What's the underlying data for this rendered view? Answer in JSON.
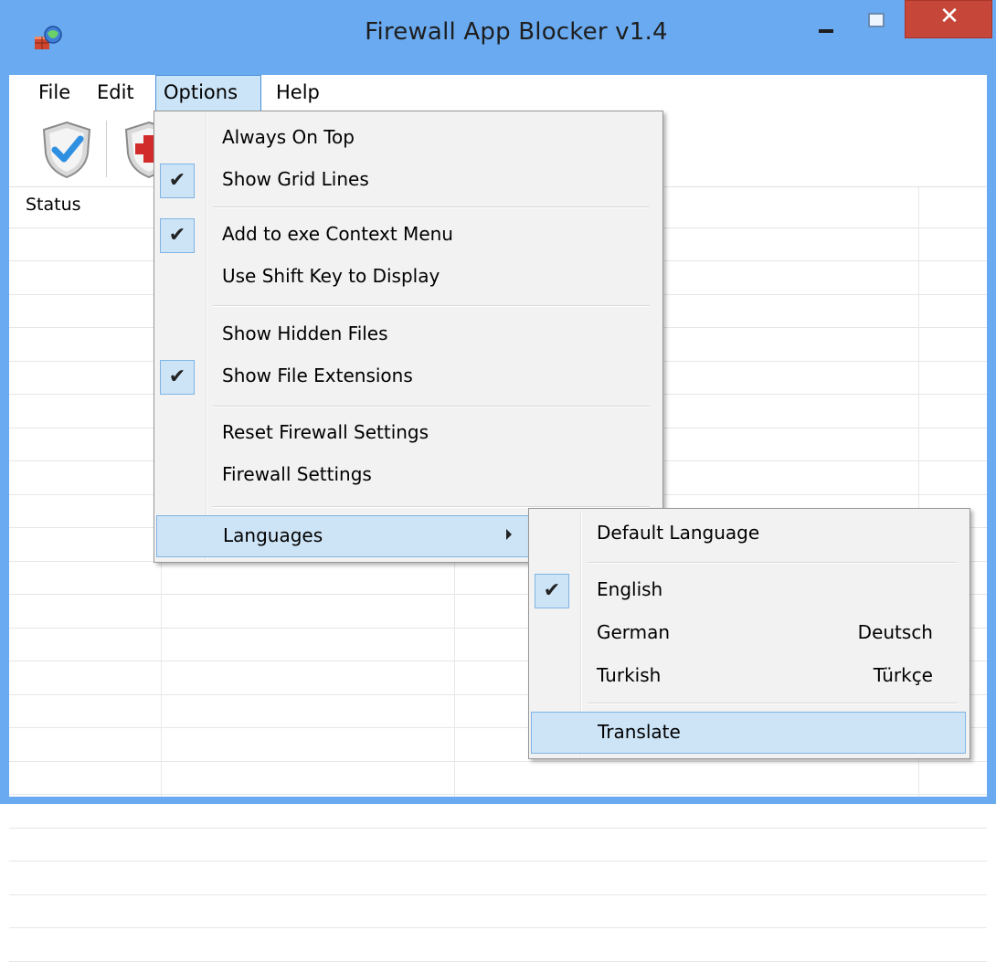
{
  "window": {
    "title": "Firewall App Blocker v1.4",
    "close_glyph": "✕"
  },
  "menubar": {
    "file": "File",
    "edit": "Edit",
    "options": "Options",
    "help": "Help"
  },
  "list": {
    "columns": [
      "Status"
    ]
  },
  "options_menu": {
    "items": [
      {
        "label": "Always On Top",
        "checked": false
      },
      {
        "label": "Show Grid Lines",
        "checked": true
      },
      {
        "label": "Add to exe Context Menu",
        "checked": true
      },
      {
        "label": "Use Shift Key to Display",
        "checked": false
      },
      {
        "label": "Show Hidden Files",
        "checked": false
      },
      {
        "label": "Show File Extensions",
        "checked": true
      },
      {
        "label": "Reset Firewall Settings",
        "checked": false
      },
      {
        "label": "Firewall Settings",
        "checked": false
      },
      {
        "label": "Languages",
        "checked": false,
        "submenu": true,
        "highlighted": true
      }
    ]
  },
  "languages_menu": {
    "items": [
      {
        "label": "Default Language",
        "native": "",
        "checked": false
      },
      {
        "label": "English",
        "native": "",
        "checked": true
      },
      {
        "label": "German",
        "native": "Deutsch",
        "checked": false
      },
      {
        "label": "Turkish",
        "native": "Türkçe",
        "checked": false
      },
      {
        "label": "Translate",
        "native": "",
        "checked": false,
        "highlighted": true
      }
    ]
  },
  "check_glyph": "✔",
  "colors": {
    "titlebar": "#6aaaf0",
    "close_button": "#c7463a",
    "highlight": "#cde4f7",
    "highlight_border": "#7fb4e3"
  },
  "icons": {
    "app": "firewall-app-icon",
    "toolbar_allow": "shield-check-icon",
    "toolbar_block": "shield-block-icon"
  }
}
